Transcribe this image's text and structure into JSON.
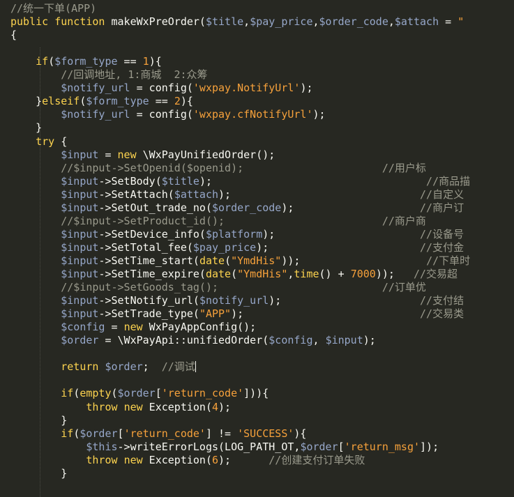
{
  "editor": {
    "theme_colors": {
      "background": "#272822",
      "keyword": "#fcd34f",
      "variable": "#96a7c9",
      "string": "#f6a13b",
      "comment": "#9a9a8c",
      "plain": "#f8f8f2"
    },
    "lines": [
      {
        "tokens": [
          {
            "t": "//统一下单(APP)",
            "c": "cm"
          }
        ]
      },
      {
        "tokens": [
          {
            "t": "public",
            "c": "kw"
          },
          {
            "t": " ",
            "c": "pl"
          },
          {
            "t": "function",
            "c": "kw"
          },
          {
            "t": " makeWxPreOrder(",
            "c": "pl"
          },
          {
            "t": "$title",
            "c": "var"
          },
          {
            "t": ",",
            "c": "pl"
          },
          {
            "t": "$pay_price",
            "c": "var"
          },
          {
            "t": ",",
            "c": "pl"
          },
          {
            "t": "$order_code",
            "c": "var"
          },
          {
            "t": ",",
            "c": "pl"
          },
          {
            "t": "$attach",
            "c": "var"
          },
          {
            "t": " = ",
            "c": "pl"
          },
          {
            "t": "\"",
            "c": "str"
          }
        ]
      },
      {
        "tokens": [
          {
            "t": "{",
            "c": "pl"
          }
        ]
      },
      {
        "tokens": []
      },
      {
        "tokens": [
          {
            "t": "    ",
            "c": "pl"
          },
          {
            "t": "if",
            "c": "kw"
          },
          {
            "t": "(",
            "c": "pl"
          },
          {
            "t": "$form_type",
            "c": "var"
          },
          {
            "t": " == ",
            "c": "pl"
          },
          {
            "t": "1",
            "c": "num"
          },
          {
            "t": "){",
            "c": "pl"
          }
        ]
      },
      {
        "tokens": [
          {
            "t": "        ",
            "c": "pl"
          },
          {
            "t": "//回调地址, 1:商城  2:众筹",
            "c": "cm"
          }
        ]
      },
      {
        "tokens": [
          {
            "t": "        ",
            "c": "pl"
          },
          {
            "t": "$notify_url",
            "c": "var"
          },
          {
            "t": " = config(",
            "c": "pl"
          },
          {
            "t": "'wxpay.NotifyUrl'",
            "c": "str"
          },
          {
            "t": ");",
            "c": "pl"
          }
        ]
      },
      {
        "tokens": [
          {
            "t": "    }",
            "c": "pl"
          },
          {
            "t": "elseif",
            "c": "kw"
          },
          {
            "t": "(",
            "c": "pl"
          },
          {
            "t": "$form_type",
            "c": "var"
          },
          {
            "t": " == ",
            "c": "pl"
          },
          {
            "t": "2",
            "c": "num"
          },
          {
            "t": "){",
            "c": "pl"
          }
        ]
      },
      {
        "tokens": [
          {
            "t": "        ",
            "c": "pl"
          },
          {
            "t": "$notify_url",
            "c": "var"
          },
          {
            "t": " = config(",
            "c": "pl"
          },
          {
            "t": "'wxpay.cfNotifyUrl'",
            "c": "str"
          },
          {
            "t": ");",
            "c": "pl"
          }
        ]
      },
      {
        "tokens": [
          {
            "t": "    }",
            "c": "pl"
          }
        ]
      },
      {
        "tokens": [
          {
            "t": "    ",
            "c": "pl"
          },
          {
            "t": "try",
            "c": "kw"
          },
          {
            "t": " {",
            "c": "pl"
          }
        ]
      },
      {
        "tokens": [
          {
            "t": "        ",
            "c": "pl"
          },
          {
            "t": "$input",
            "c": "var"
          },
          {
            "t": " = ",
            "c": "pl"
          },
          {
            "t": "new",
            "c": "kw"
          },
          {
            "t": " \\WxPayUnifiedOrder();",
            "c": "pl"
          }
        ]
      },
      {
        "tokens": [
          {
            "t": "        ",
            "c": "pl"
          },
          {
            "t": "//$input->SetOpenid($openid);",
            "c": "cm"
          },
          {
            "t": "                      ",
            "c": "pl"
          },
          {
            "t": "//用户标",
            "c": "cm"
          }
        ]
      },
      {
        "tokens": [
          {
            "t": "        ",
            "c": "pl"
          },
          {
            "t": "$input",
            "c": "var"
          },
          {
            "t": "->SetBody(",
            "c": "pl"
          },
          {
            "t": "$title",
            "c": "var"
          },
          {
            "t": ");",
            "c": "pl"
          },
          {
            "t": "                                  ",
            "c": "pl"
          },
          {
            "t": "//商品描",
            "c": "cm"
          }
        ]
      },
      {
        "tokens": [
          {
            "t": "        ",
            "c": "pl"
          },
          {
            "t": "$input",
            "c": "var"
          },
          {
            "t": "->SetAttach(",
            "c": "pl"
          },
          {
            "t": "$attach",
            "c": "var"
          },
          {
            "t": ");",
            "c": "pl"
          },
          {
            "t": "                              ",
            "c": "pl"
          },
          {
            "t": "//自定义",
            "c": "cm"
          }
        ]
      },
      {
        "tokens": [
          {
            "t": "        ",
            "c": "pl"
          },
          {
            "t": "$input",
            "c": "var"
          },
          {
            "t": "->SetOut_trade_no(",
            "c": "pl"
          },
          {
            "t": "$order_code",
            "c": "var"
          },
          {
            "t": ");",
            "c": "pl"
          },
          {
            "t": "                    ",
            "c": "pl"
          },
          {
            "t": "//商户订",
            "c": "cm"
          }
        ]
      },
      {
        "tokens": [
          {
            "t": "        ",
            "c": "pl"
          },
          {
            "t": "//$input->SetProduct_id();",
            "c": "cm"
          },
          {
            "t": "                         ",
            "c": "pl"
          },
          {
            "t": "//商户商",
            "c": "cm"
          }
        ]
      },
      {
        "tokens": [
          {
            "t": "        ",
            "c": "pl"
          },
          {
            "t": "$input",
            "c": "var"
          },
          {
            "t": "->SetDevice_info(",
            "c": "pl"
          },
          {
            "t": "$platform",
            "c": "var"
          },
          {
            "t": ");",
            "c": "pl"
          },
          {
            "t": "                       ",
            "c": "pl"
          },
          {
            "t": "//设备号",
            "c": "cm"
          }
        ]
      },
      {
        "tokens": [
          {
            "t": "        ",
            "c": "pl"
          },
          {
            "t": "$input",
            "c": "var"
          },
          {
            "t": "->SetTotal_fee(",
            "c": "pl"
          },
          {
            "t": "$pay_price",
            "c": "var"
          },
          {
            "t": ");",
            "c": "pl"
          },
          {
            "t": "                        ",
            "c": "pl"
          },
          {
            "t": "//支付金",
            "c": "cm"
          }
        ]
      },
      {
        "tokens": [
          {
            "t": "        ",
            "c": "pl"
          },
          {
            "t": "$input",
            "c": "var"
          },
          {
            "t": "->SetTime_start(",
            "c": "pl"
          },
          {
            "t": "date",
            "c": "kw"
          },
          {
            "t": "(",
            "c": "pl"
          },
          {
            "t": "\"YmdHis\"",
            "c": "str"
          },
          {
            "t": "));",
            "c": "pl"
          },
          {
            "t": "                    ",
            "c": "pl"
          },
          {
            "t": "//下单时",
            "c": "cm"
          }
        ]
      },
      {
        "tokens": [
          {
            "t": "        ",
            "c": "pl"
          },
          {
            "t": "$input",
            "c": "var"
          },
          {
            "t": "->SetTime_expire(",
            "c": "pl"
          },
          {
            "t": "date",
            "c": "kw"
          },
          {
            "t": "(",
            "c": "pl"
          },
          {
            "t": "\"YmdHis\"",
            "c": "str"
          },
          {
            "t": ",",
            "c": "pl"
          },
          {
            "t": "time",
            "c": "kw"
          },
          {
            "t": "() + ",
            "c": "pl"
          },
          {
            "t": "7000",
            "c": "num"
          },
          {
            "t": "));",
            "c": "pl"
          },
          {
            "t": "   ",
            "c": "pl"
          },
          {
            "t": "//交易超",
            "c": "cm"
          }
        ]
      },
      {
        "tokens": [
          {
            "t": "        ",
            "c": "pl"
          },
          {
            "t": "//$input->SetGoods_tag();",
            "c": "cm"
          },
          {
            "t": "                          ",
            "c": "pl"
          },
          {
            "t": "//订单优",
            "c": "cm"
          }
        ]
      },
      {
        "tokens": [
          {
            "t": "        ",
            "c": "pl"
          },
          {
            "t": "$input",
            "c": "var"
          },
          {
            "t": "->SetNotify_url(",
            "c": "pl"
          },
          {
            "t": "$notify_url",
            "c": "var"
          },
          {
            "t": ");",
            "c": "pl"
          },
          {
            "t": "                      ",
            "c": "pl"
          },
          {
            "t": "//支付结",
            "c": "cm"
          }
        ]
      },
      {
        "tokens": [
          {
            "t": "        ",
            "c": "pl"
          },
          {
            "t": "$input",
            "c": "var"
          },
          {
            "t": "->SetTrade_type(",
            "c": "pl"
          },
          {
            "t": "\"APP\"",
            "c": "str"
          },
          {
            "t": ");",
            "c": "pl"
          },
          {
            "t": "                            ",
            "c": "pl"
          },
          {
            "t": "//交易类",
            "c": "cm"
          }
        ]
      },
      {
        "tokens": [
          {
            "t": "        ",
            "c": "pl"
          },
          {
            "t": "$config",
            "c": "var"
          },
          {
            "t": " = ",
            "c": "pl"
          },
          {
            "t": "new",
            "c": "kw"
          },
          {
            "t": " WxPayAppConfig();",
            "c": "pl"
          }
        ]
      },
      {
        "tokens": [
          {
            "t": "        ",
            "c": "pl"
          },
          {
            "t": "$order",
            "c": "var"
          },
          {
            "t": " = \\WxPayApi::unifiedOrder(",
            "c": "pl"
          },
          {
            "t": "$config",
            "c": "var"
          },
          {
            "t": ", ",
            "c": "pl"
          },
          {
            "t": "$input",
            "c": "var"
          },
          {
            "t": ");",
            "c": "pl"
          }
        ]
      },
      {
        "tokens": []
      },
      {
        "tokens": [
          {
            "t": "        ",
            "c": "pl"
          },
          {
            "t": "return",
            "c": "kw"
          },
          {
            "t": " ",
            "c": "pl"
          },
          {
            "t": "$order",
            "c": "var"
          },
          {
            "t": ";  ",
            "c": "pl"
          },
          {
            "t": "//调试",
            "c": "cm"
          }
        ],
        "cursor": true
      },
      {
        "tokens": []
      },
      {
        "tokens": [
          {
            "t": "        ",
            "c": "pl"
          },
          {
            "t": "if",
            "c": "kw"
          },
          {
            "t": "(",
            "c": "pl"
          },
          {
            "t": "empty",
            "c": "kw"
          },
          {
            "t": "(",
            "c": "pl"
          },
          {
            "t": "$order",
            "c": "var"
          },
          {
            "t": "[",
            "c": "pl"
          },
          {
            "t": "'return_code'",
            "c": "str"
          },
          {
            "t": "])){",
            "c": "pl"
          }
        ]
      },
      {
        "tokens": [
          {
            "t": "            ",
            "c": "pl"
          },
          {
            "t": "throw",
            "c": "kw"
          },
          {
            "t": " ",
            "c": "pl"
          },
          {
            "t": "new",
            "c": "kw"
          },
          {
            "t": " Exception(",
            "c": "pl"
          },
          {
            "t": "4",
            "c": "num"
          },
          {
            "t": ");",
            "c": "pl"
          }
        ]
      },
      {
        "tokens": [
          {
            "t": "        }",
            "c": "pl"
          }
        ]
      },
      {
        "tokens": [
          {
            "t": "        ",
            "c": "pl"
          },
          {
            "t": "if",
            "c": "kw"
          },
          {
            "t": "(",
            "c": "pl"
          },
          {
            "t": "$order",
            "c": "var"
          },
          {
            "t": "[",
            "c": "pl"
          },
          {
            "t": "'return_code'",
            "c": "str"
          },
          {
            "t": "] != ",
            "c": "pl"
          },
          {
            "t": "'SUCCESS'",
            "c": "str"
          },
          {
            "t": "){",
            "c": "pl"
          }
        ]
      },
      {
        "tokens": [
          {
            "t": "            ",
            "c": "pl"
          },
          {
            "t": "$this",
            "c": "var"
          },
          {
            "t": "->writeErrorLogs(LOG_PATH_OT,",
            "c": "pl"
          },
          {
            "t": "$order",
            "c": "var"
          },
          {
            "t": "[",
            "c": "pl"
          },
          {
            "t": "'return_msg'",
            "c": "str"
          },
          {
            "t": "]);",
            "c": "pl"
          }
        ]
      },
      {
        "tokens": [
          {
            "t": "            ",
            "c": "pl"
          },
          {
            "t": "throw",
            "c": "kw"
          },
          {
            "t": " ",
            "c": "pl"
          },
          {
            "t": "new",
            "c": "kw"
          },
          {
            "t": " Exception(",
            "c": "pl"
          },
          {
            "t": "6",
            "c": "num"
          },
          {
            "t": ");      ",
            "c": "pl"
          },
          {
            "t": "//创建支付订单失败",
            "c": "cm"
          }
        ]
      },
      {
        "tokens": [
          {
            "t": "        }",
            "c": "pl"
          }
        ]
      },
      {
        "tokens": []
      }
    ]
  }
}
